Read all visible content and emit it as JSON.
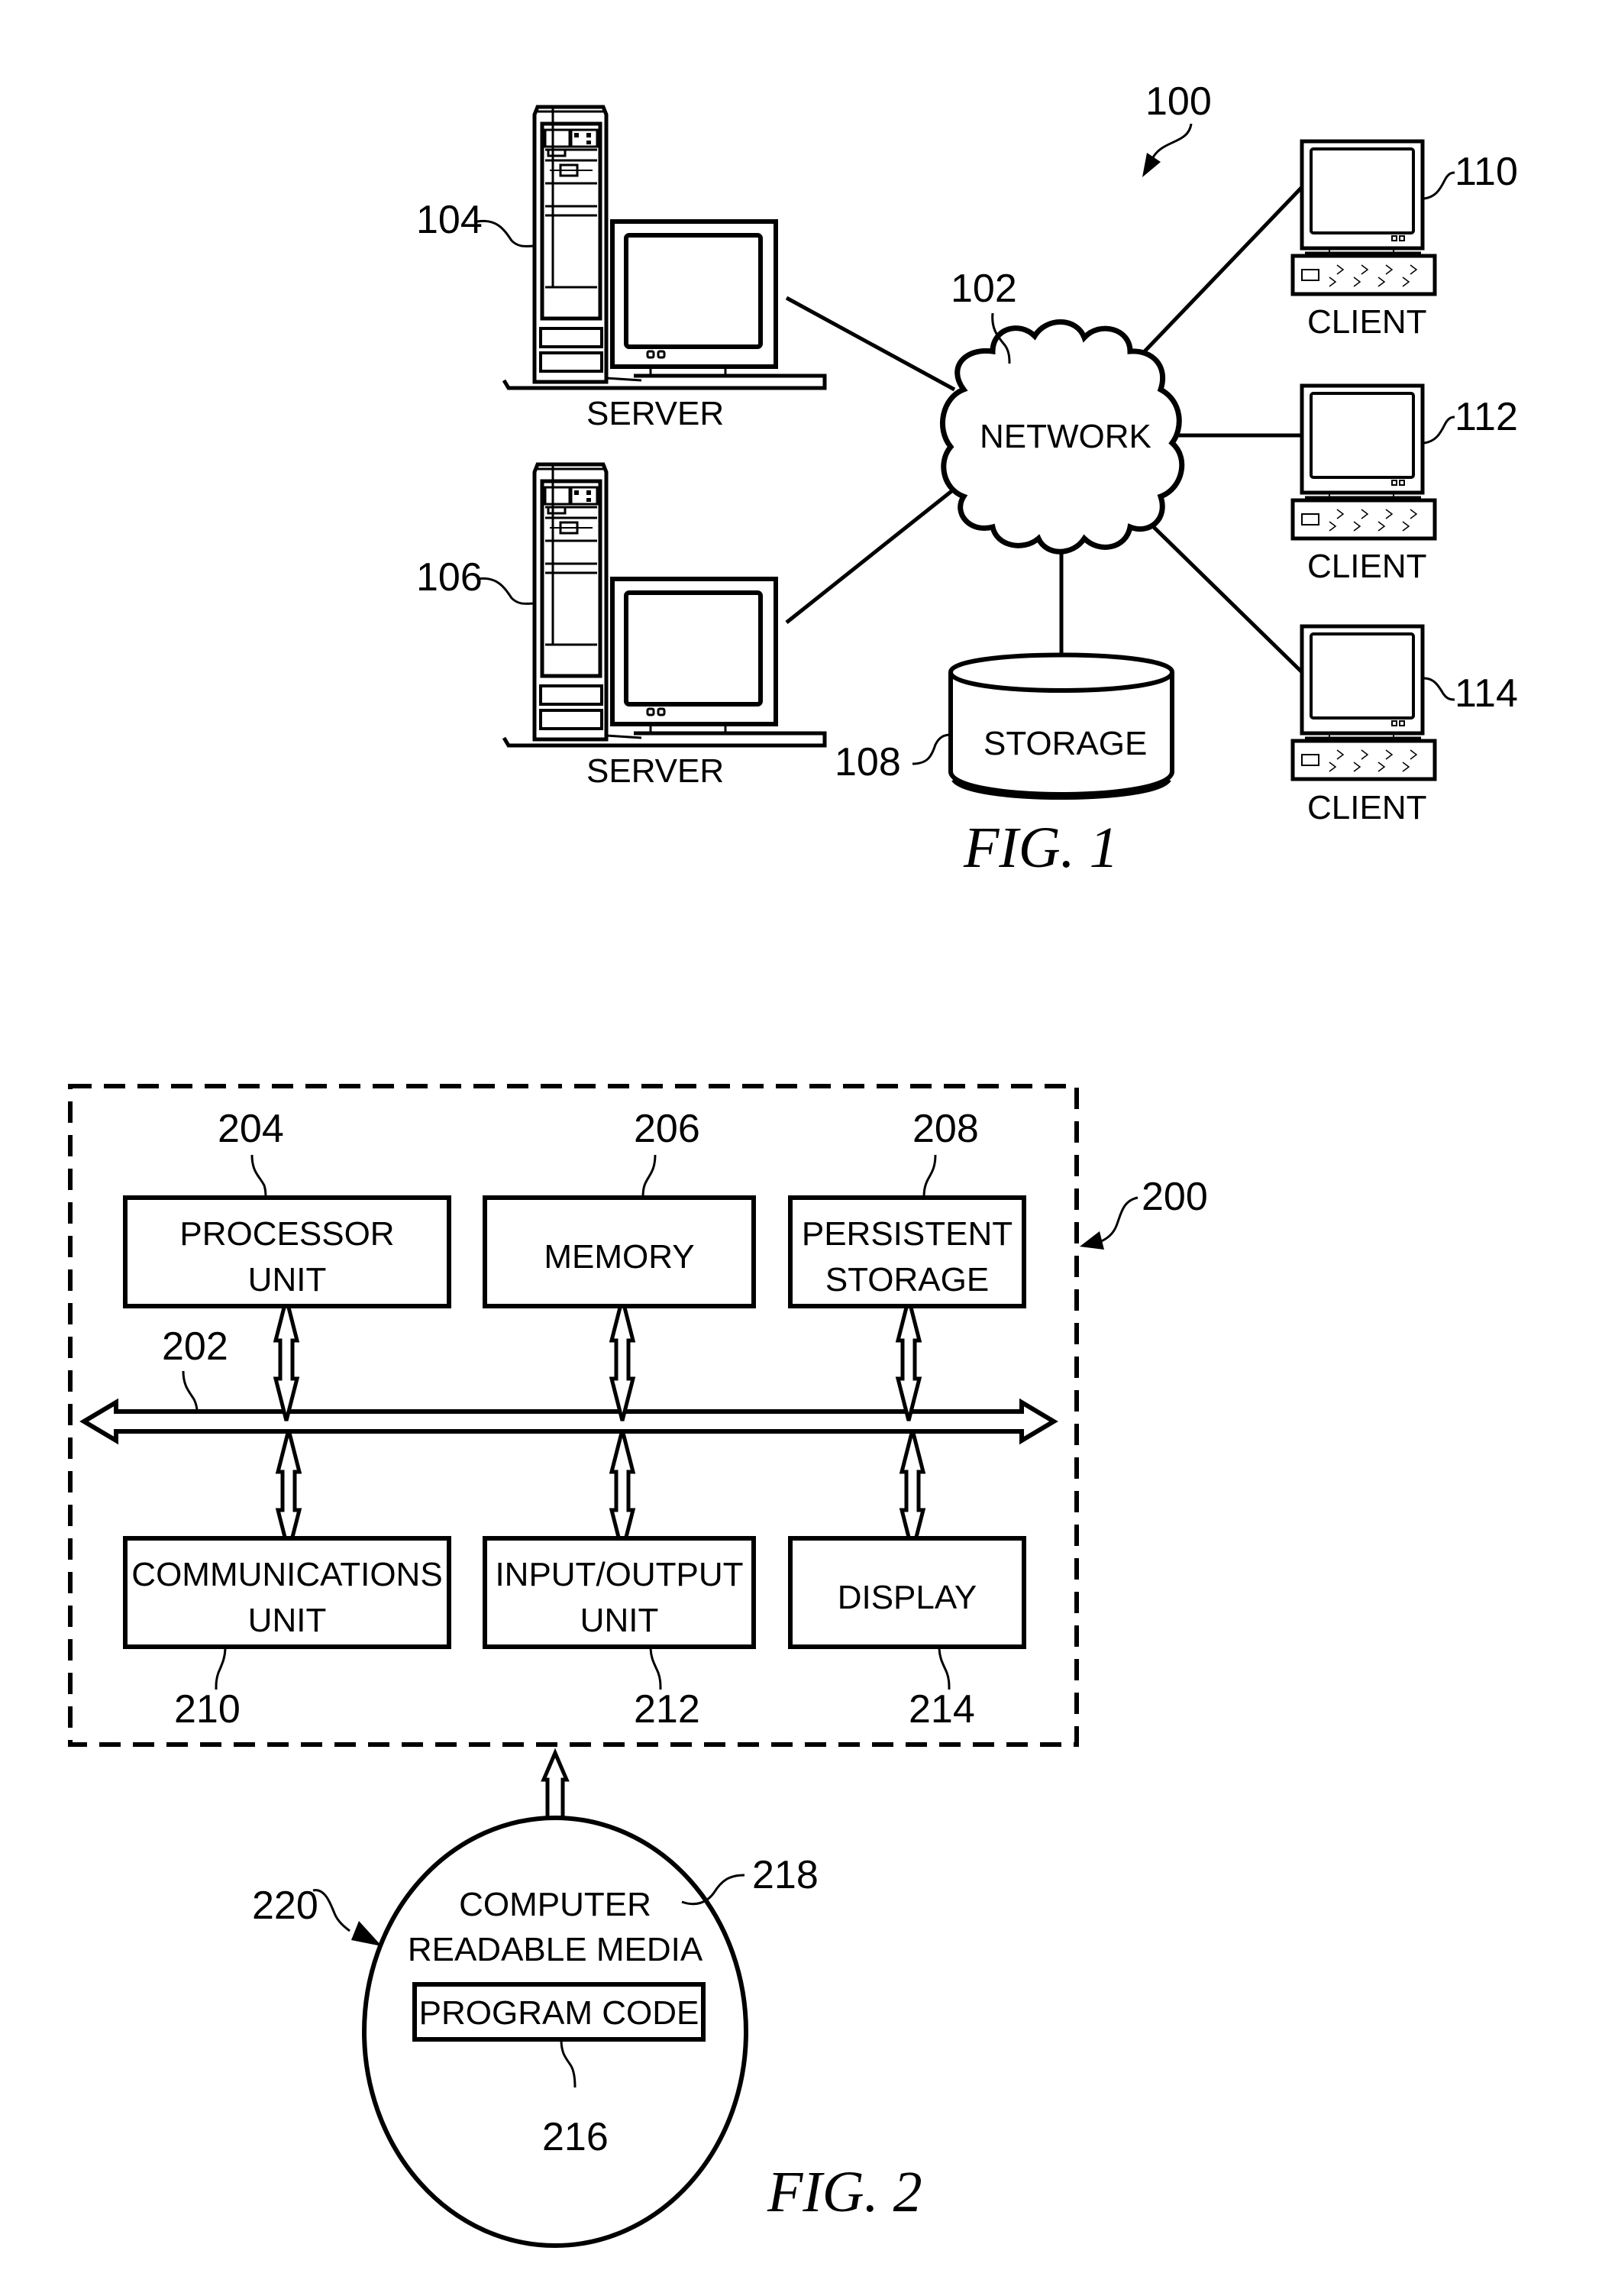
{
  "figure1": {
    "caption": "FIG. 1",
    "system_ref": "100",
    "network": {
      "ref": "102",
      "label": "NETWORK"
    },
    "servers": [
      {
        "ref": "104",
        "label": "SERVER"
      },
      {
        "ref": "106",
        "label": "SERVER"
      }
    ],
    "storage": {
      "ref": "108",
      "label": "STORAGE"
    },
    "clients": [
      {
        "ref": "110",
        "label": "CLIENT"
      },
      {
        "ref": "112",
        "label": "CLIENT"
      },
      {
        "ref": "114",
        "label": "CLIENT"
      }
    ]
  },
  "figure2": {
    "caption": "FIG. 2",
    "system_ref": "200",
    "bus_ref": "202",
    "top_units": [
      {
        "ref": "204",
        "line1": "PROCESSOR",
        "line2": "UNIT"
      },
      {
        "ref": "206",
        "line1": "MEMORY",
        "line2": ""
      },
      {
        "ref": "208",
        "line1": "PERSISTENT",
        "line2": "STORAGE"
      }
    ],
    "bottom_units": [
      {
        "ref": "210",
        "line1": "COMMUNICATIONS",
        "line2": "UNIT"
      },
      {
        "ref": "212",
        "line1": "INPUT/OUTPUT",
        "line2": "UNIT"
      },
      {
        "ref": "214",
        "line1": "DISPLAY",
        "line2": ""
      }
    ],
    "media": {
      "ref": "220",
      "media_ref": "218",
      "line1": "COMPUTER",
      "line2": "READABLE MEDIA",
      "program_code": {
        "ref": "216",
        "label": "PROGRAM CODE"
      }
    }
  }
}
